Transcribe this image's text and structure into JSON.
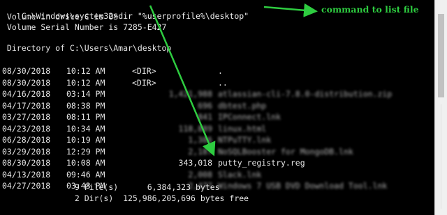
{
  "console": {
    "prompt": "C:\\Windows\\system32>",
    "command": "dir \"%userprofile%\\desktop\"",
    "volume_line": " Volume in drive C is OS",
    "serial_line": " Volume Serial Number is 7285-E427",
    "directory_line": " Directory of C:\\Users\\Amar\\desktop",
    "entries": [
      {
        "date": "08/30/2018",
        "time": "10:12 AM",
        "type": "<DIR>",
        "size": "",
        "name": "."
      },
      {
        "date": "08/30/2018",
        "time": "10:12 AM",
        "type": "<DIR>",
        "size": "",
        "name": ".."
      },
      {
        "date": "04/16/2018",
        "time": "03:14 PM",
        "type": "",
        "size": "1,421,988",
        "name": "atlassian-cli-7.8.0-distribution.zip"
      },
      {
        "date": "04/17/2018",
        "time": "08:38 PM",
        "type": "",
        "size": "696",
        "name": "dbtest.php"
      },
      {
        "date": "03/27/2018",
        "time": "08:11 PM",
        "type": "",
        "size": "841",
        "name": "IPConnect.lnk"
      },
      {
        "date": "04/23/2018",
        "time": "10:34 AM",
        "type": "",
        "size": "118,889",
        "name": "linux.html"
      },
      {
        "date": "06/28/2018",
        "time": "10:19 AM",
        "type": "",
        "size": "1,386",
        "name": "NTPuTTY.lnk"
      },
      {
        "date": "03/29/2018",
        "time": "12:29 PM",
        "type": "",
        "size": "2,187",
        "name": "NoSQLBooster for MongoDB.lnk"
      },
      {
        "date": "08/30/2018",
        "time": "10:08 AM",
        "type": "",
        "size": "343,018",
        "name": "putty_registry.reg"
      },
      {
        "date": "04/13/2018",
        "time": "09:46 AM",
        "type": "",
        "size": "2,008",
        "name": "Slack.lnk"
      },
      {
        "date": "04/27/2018",
        "time": "03:43 PM",
        "type": "",
        "size": "2,477",
        "name": "Windows 7 USB DVD Download Tool.lnk"
      }
    ],
    "files_summary": "               9 File(s)      6,384,323 bytes",
    "dirs_summary": "               2 Dir(s)  125,986,205,696 bytes free"
  },
  "annotation": {
    "label": "command to list file",
    "color": "#2ecc40"
  },
  "colors": {
    "background": "#000000",
    "text": "#e6e6e6",
    "arrow": "#2ecc40"
  }
}
